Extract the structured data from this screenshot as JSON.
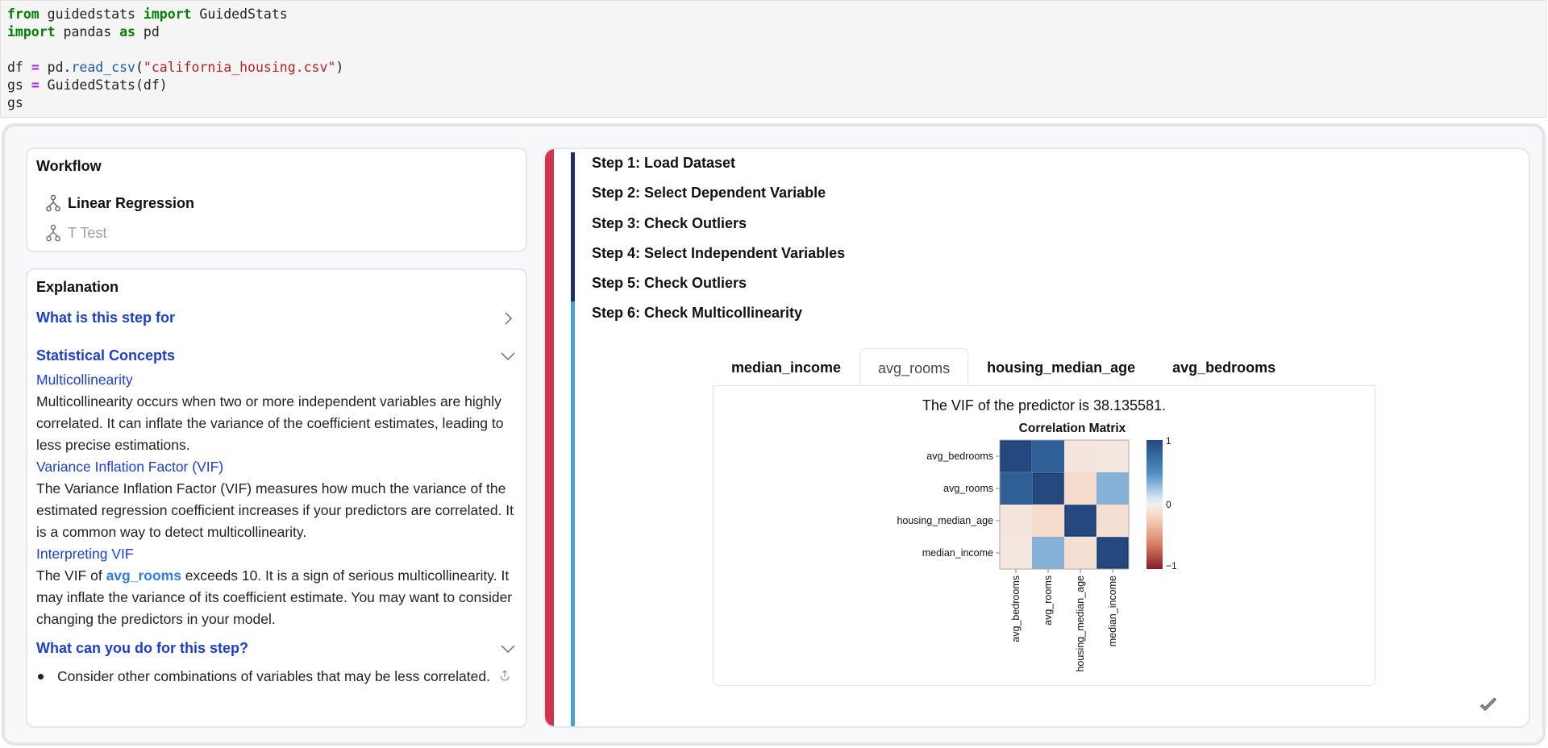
{
  "code_cell": {
    "lines": [
      [
        {
          "t": "from",
          "c": "kw"
        },
        {
          "t": " guidedstats ",
          "c": ""
        },
        {
          "t": "import",
          "c": "kw"
        },
        {
          "t": " GuidedStats",
          "c": ""
        }
      ],
      [
        {
          "t": "import",
          "c": "kw"
        },
        {
          "t": " pandas ",
          "c": ""
        },
        {
          "t": "as",
          "c": "kw"
        },
        {
          "t": " pd",
          "c": ""
        }
      ],
      [],
      [
        {
          "t": "df ",
          "c": ""
        },
        {
          "t": "=",
          "c": "op"
        },
        {
          "t": " pd.",
          "c": ""
        },
        {
          "t": "read_csv",
          "c": "fn"
        },
        {
          "t": "(",
          "c": ""
        },
        {
          "t": "\"california_housing.csv\"",
          "c": "str"
        },
        {
          "t": ")",
          "c": ""
        }
      ],
      [
        {
          "t": "gs ",
          "c": ""
        },
        {
          "t": "=",
          "c": "op"
        },
        {
          "t": " GuidedStats(df)",
          "c": ""
        }
      ],
      [
        {
          "t": "gs",
          "c": ""
        }
      ]
    ]
  },
  "workflow": {
    "title": "Workflow",
    "items": [
      {
        "label": "Linear Regression",
        "active": true,
        "icon": "workflow-branch-icon"
      },
      {
        "label": "T Test",
        "active": false,
        "icon": "workflow-branch-icon"
      }
    ]
  },
  "explanation": {
    "title": "Explanation",
    "sections": {
      "what_is": {
        "label": "What is this step for",
        "expanded": false
      },
      "concepts": {
        "label": "Statistical Concepts",
        "expanded": true,
        "multicollinearity_head": "Multicollinearity",
        "multicollinearity_text": "Multicollinearity occurs when two or more independent variables are highly correlated. It can inflate the variance of the coefficient estimates, leading to less precise estimations.",
        "vif_head": "Variance Inflation Factor (VIF)",
        "vif_text": "The Variance Inflation Factor (VIF) measures how much the variance of the estimated regression coefficient increases if your predictors are correlated. It is a common way to detect multicollinearity.",
        "interp_head": "Interpreting VIF",
        "interp_pre": "The VIF of ",
        "interp_var": "avg_rooms",
        "interp_post": " exceeds 10. It is a sign of serious multicollinearity. It may inflate the variance of its coefficient estimate. You may want to consider changing the predictors in your model."
      },
      "what_can": {
        "label": "What can you do for this step?",
        "expanded": true,
        "bullets": [
          "Consider other combinations of variables that may be less correlated."
        ]
      }
    }
  },
  "steps": [
    "Step 1: Load Dataset",
    "Step 2: Select Dependent Variable",
    "Step 3: Check Outliers",
    "Step 4: Select Independent Variables",
    "Step 5: Check Outliers",
    "Step 6: Check Multicollinearity"
  ],
  "colors": {
    "accent_red": "#d0354c",
    "progress_done": "#1f2f6b",
    "progress_current": "#4a9fd7",
    "link_blue": "#1a3fd0",
    "highlight_blue": "#2f7de0"
  },
  "tabs": [
    {
      "label": "median_income",
      "active": false
    },
    {
      "label": "avg_rooms",
      "active": true
    },
    {
      "label": "housing_median_age",
      "active": false
    },
    {
      "label": "avg_bedrooms",
      "active": false
    }
  ],
  "vif_text": "The VIF of the predictor is 38.135581.",
  "chart_data": {
    "type": "heatmap",
    "title": "Correlation Matrix",
    "rows": [
      "avg_bedrooms",
      "avg_rooms",
      "housing_median_age",
      "median_income"
    ],
    "cols": [
      "avg_bedrooms",
      "avg_rooms",
      "housing_median_age",
      "median_income"
    ],
    "values": [
      [
        1.0,
        0.85,
        -0.07,
        -0.06
      ],
      [
        0.85,
        1.0,
        -0.15,
        0.33
      ],
      [
        -0.07,
        -0.15,
        1.0,
        -0.12
      ],
      [
        -0.06,
        0.33,
        -0.12,
        1.0
      ]
    ],
    "color_scale": {
      "min": -1,
      "max": 1,
      "ticks": [
        "1",
        "0",
        "−1"
      ],
      "scheme": "red-white-blue"
    },
    "legend_placement": "right"
  }
}
